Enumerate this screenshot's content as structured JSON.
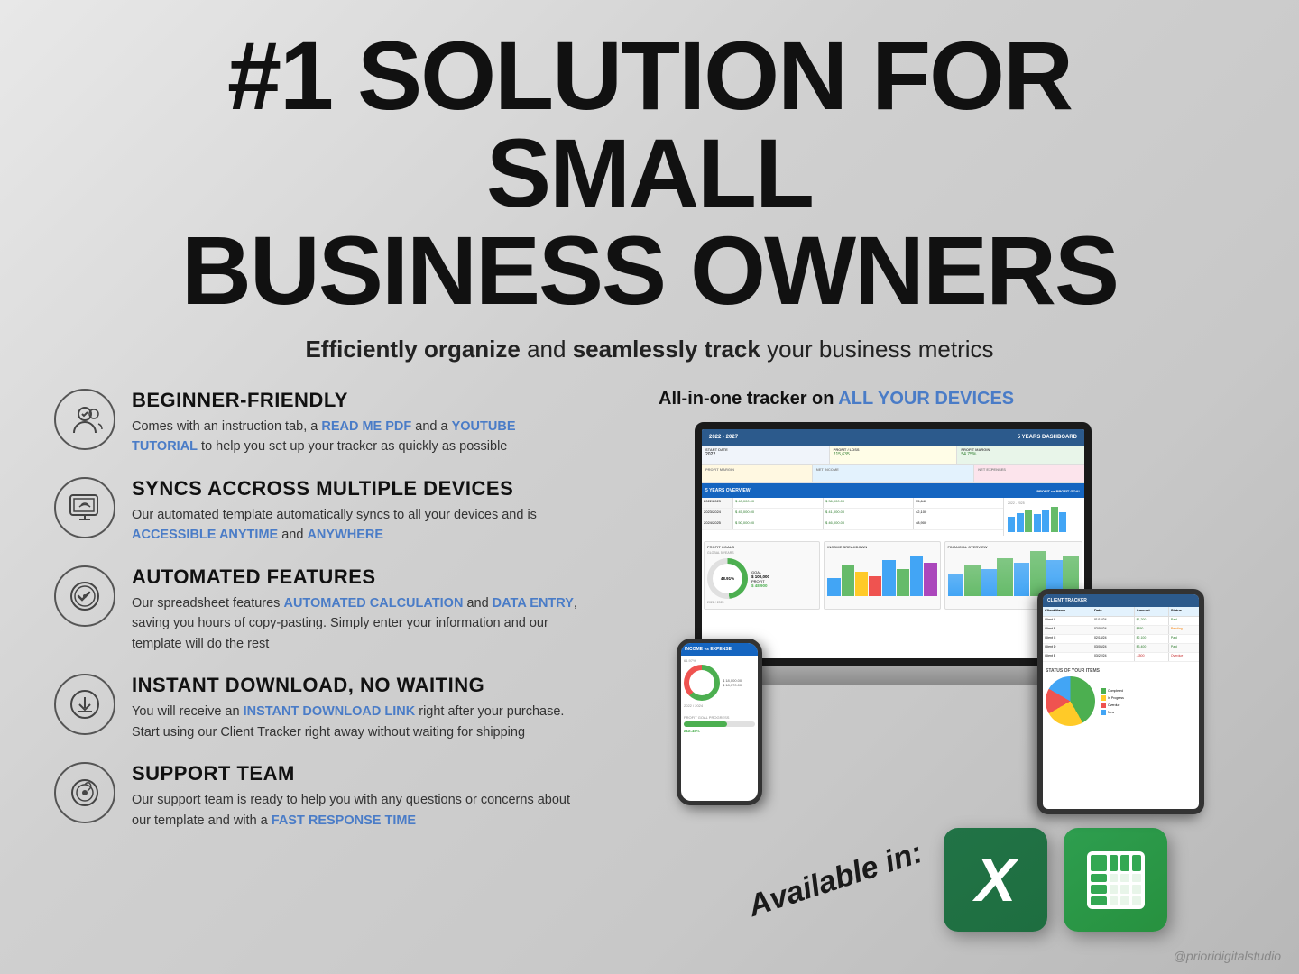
{
  "page": {
    "background": "#d4d4d4"
  },
  "header": {
    "main_title": "#1 SOLUTION FOR SMALL BUSINESS OWNERS",
    "title_line1": "#1 SOLUTION FOR SMALL",
    "title_line2": "BUSINESS OWNERS",
    "subtitle": "Efficiently organize and seamlessly track your business metrics",
    "subtitle_bold1": "Efficiently organize",
    "subtitle_bold2": "seamlessly track"
  },
  "features": [
    {
      "id": "beginner-friendly",
      "icon": "🌱",
      "title": "BEGINNER-FRIENDLY",
      "description": "Comes with an instruction tab, a READ ME PDF and a YOUTUBE TUTORIAL to help you set up your tracker as quickly as possible",
      "highlights": [
        {
          "text": "READ ME PDF",
          "color": "blue"
        },
        {
          "text": "YOUTUBE TUTORIAL",
          "color": "blue"
        }
      ]
    },
    {
      "id": "syncs-devices",
      "icon": "🖥",
      "title": "SYNCS ACCROSS MULTIPLE DEVICES",
      "description": "Our automated template automatically syncs to all your devices and is ACCESSIBLE ANYTIME and ANYWHERE",
      "highlights": [
        {
          "text": "ACCESSIBLE ANYTIME",
          "color": "blue"
        },
        {
          "text": "ANYWHERE",
          "color": "blue"
        }
      ]
    },
    {
      "id": "automated-features",
      "icon": "✅",
      "title": "AUTOMATED FEATURES",
      "description": "Our spreadsheet features AUTOMATED CALCULATION and DATA ENTRY, saving you hours of copy-pasting. Simply enter your information and our template will do the rest",
      "highlights": [
        {
          "text": "AUTOMATED CALCULATION",
          "color": "blue"
        },
        {
          "text": "DATA ENTRY",
          "color": "blue"
        }
      ]
    },
    {
      "id": "instant-download",
      "icon": "⬇",
      "title": "INSTANT DOWNLOAD, NO WAITING",
      "description": "You will receive an INSTANT DOWNLOAD LINK right after your purchase. Start using our Client Tracker right away without waiting for shipping",
      "highlights": [
        {
          "text": "INSTANT DOWNLOAD LINK",
          "color": "blue"
        }
      ]
    },
    {
      "id": "support-team",
      "icon": "🔧",
      "title": "SUPPORT TEAM",
      "description": "Our support team is ready to help you with any questions or concerns about our template and with a FAST RESPONSE TIME",
      "highlights": [
        {
          "text": "FAST RESPONSE TIME",
          "color": "blue"
        }
      ]
    }
  ],
  "right_section": {
    "title": "All-in-one tracker on",
    "title_highlight": "ALL YOUR DEVICES",
    "available_label": "Available in:",
    "apps": [
      {
        "name": "Microsoft Excel",
        "short": "X"
      },
      {
        "name": "Google Sheets",
        "short": "GS"
      }
    ]
  },
  "watermark": {
    "text": "@prioridigitalstudio"
  }
}
